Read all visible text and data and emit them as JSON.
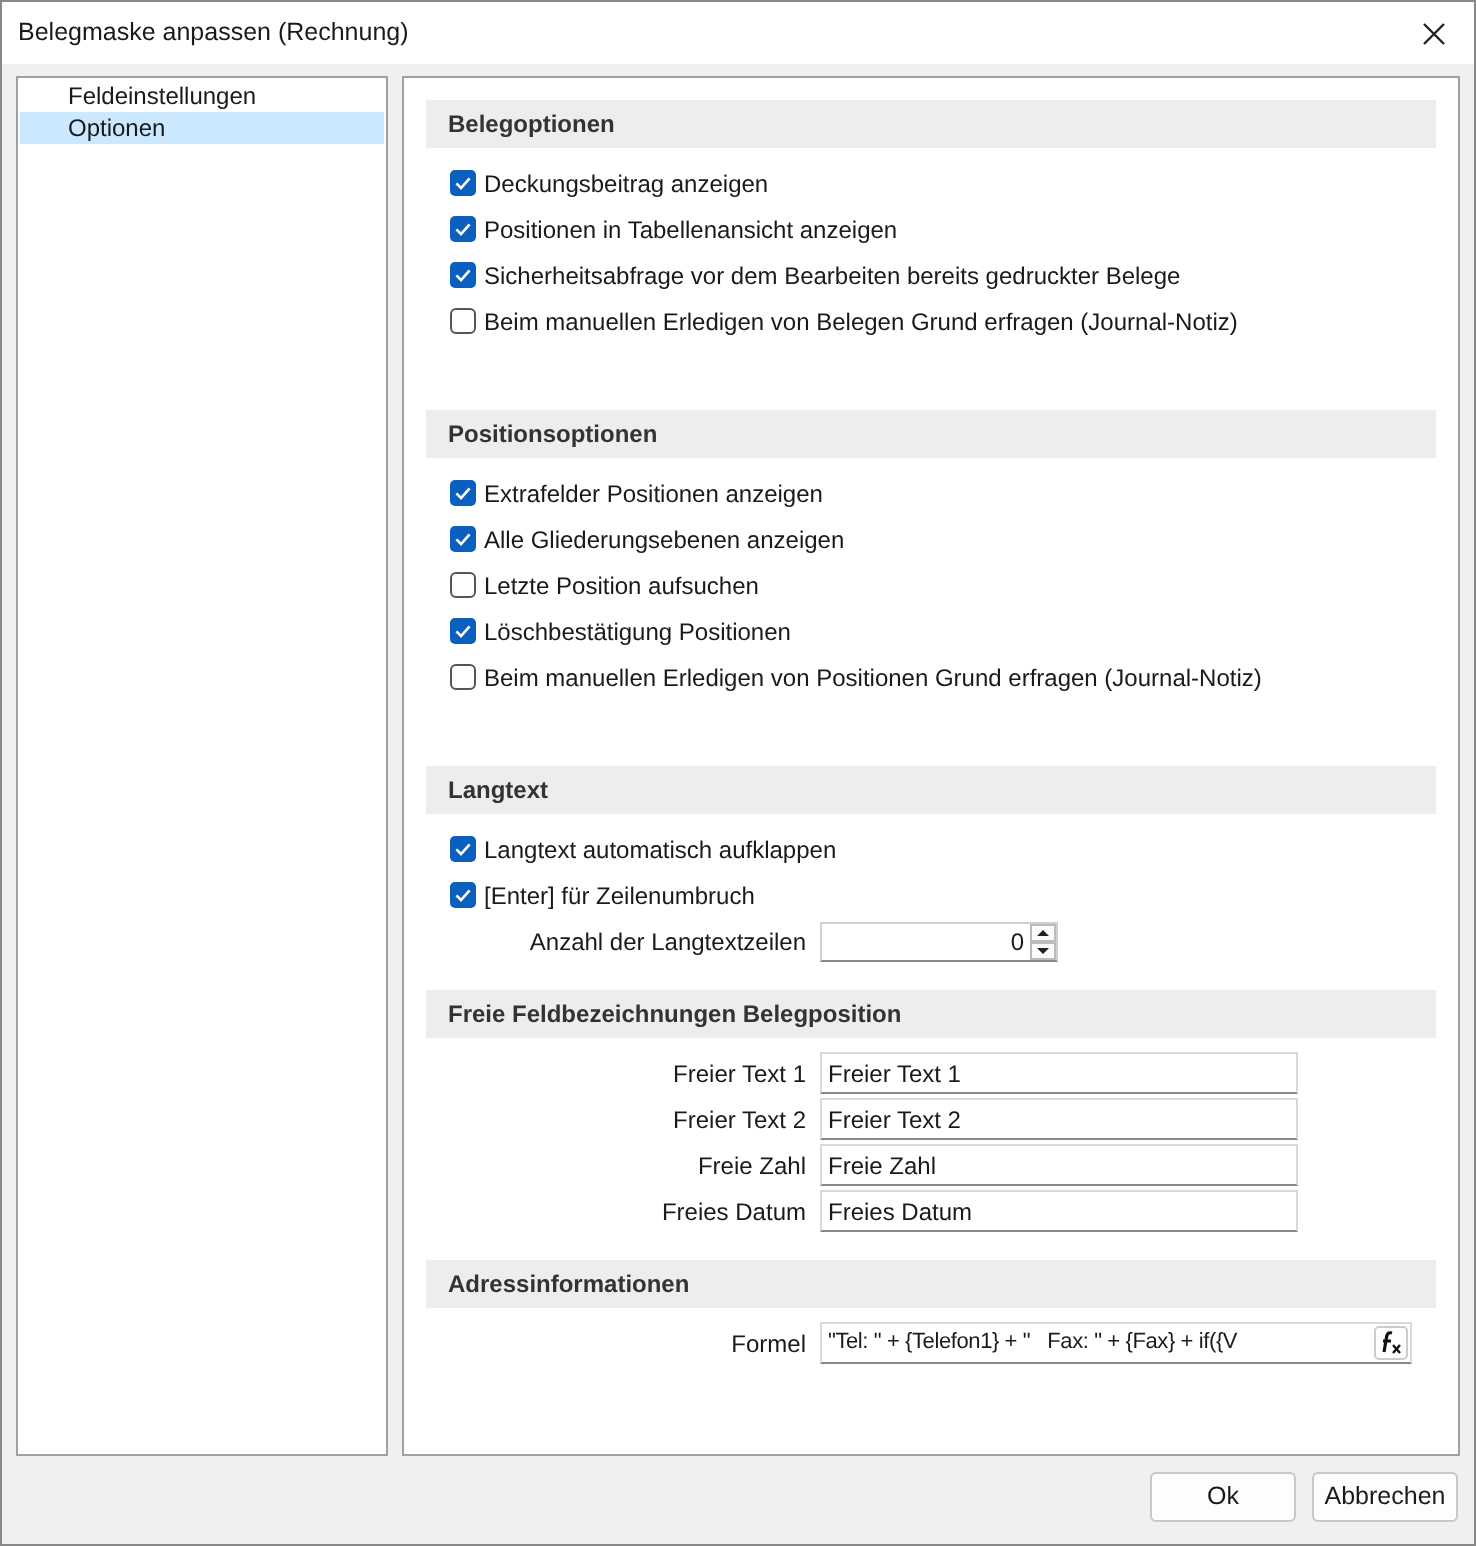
{
  "window": {
    "title": "Belegmaske anpassen (Rechnung)"
  },
  "sidebar": {
    "items": [
      {
        "label": "Feldeinstellungen",
        "selected": false
      },
      {
        "label": "Optionen",
        "selected": true
      }
    ]
  },
  "sections": [
    {
      "title": "Belegoptionen",
      "items": [
        {
          "kind": "checkbox",
          "label": "Deckungsbeitrag anzeigen",
          "checked": true
        },
        {
          "kind": "checkbox",
          "label": "Positionen in Tabellenansicht anzeigen",
          "checked": true
        },
        {
          "kind": "checkbox",
          "label": "Sicherheitsabfrage vor dem Bearbeiten bereits gedruckter Belege",
          "checked": true
        },
        {
          "kind": "checkbox",
          "label": "Beim manuellen Erledigen von Belegen Grund erfragen (Journal-Notiz)",
          "checked": false
        }
      ]
    },
    {
      "title": "Positionsoptionen",
      "items": [
        {
          "kind": "checkbox",
          "label": "Extrafelder Positionen anzeigen",
          "checked": true
        },
        {
          "kind": "checkbox",
          "label": "Alle Gliederungsebenen anzeigen",
          "checked": true
        },
        {
          "kind": "checkbox",
          "label": "Letzte Position aufsuchen",
          "checked": false
        },
        {
          "kind": "checkbox",
          "label": "Löschbestätigung Positionen",
          "checked": true
        },
        {
          "kind": "checkbox",
          "label": "Beim manuellen Erledigen von Positionen Grund erfragen (Journal-Notiz)",
          "checked": false
        }
      ]
    },
    {
      "title": "Langtext",
      "items": [
        {
          "kind": "checkbox",
          "label": "Langtext automatisch aufklappen",
          "checked": true
        },
        {
          "kind": "checkbox",
          "label": "[Enter] für Zeilenumbruch",
          "checked": true
        },
        {
          "kind": "spinner",
          "label": "Anzahl der Langtextzeilen",
          "value": "0"
        }
      ]
    },
    {
      "title": "Freie Feldbezeichnungen Belegposition",
      "items": [
        {
          "kind": "text",
          "label": "Freier Text 1",
          "value": "Freier Text 1"
        },
        {
          "kind": "text",
          "label": "Freier Text 2",
          "value": "Freier Text 2"
        },
        {
          "kind": "text",
          "label": "Freie Zahl",
          "value": "Freie Zahl"
        },
        {
          "kind": "text",
          "label": "Freies Datum",
          "value": "Freies Datum"
        }
      ]
    },
    {
      "title": "Adressinformationen",
      "items": [
        {
          "kind": "formula",
          "label": "Formel",
          "value": "\"Tel: \" + {Telefon1} + \"   Fax: \" + {Fax} + if({V"
        }
      ]
    }
  ],
  "buttons": [
    "Ok",
    "Abbrechen"
  ]
}
